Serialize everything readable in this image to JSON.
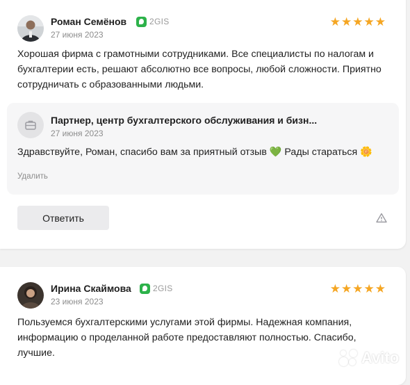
{
  "reviews": [
    {
      "author": "Роман Семёнов",
      "source": "2GIS",
      "date": "27 июня 2023",
      "rating": 5,
      "stars": "★★★★★",
      "text": "Хорошая фирма с грамотными сотрудниками. Все специалисты по налогам и бухгалтерии есть, решают абсолютно все вопросы, любой сложности. Приятно сотрудничать с образованными людьми.",
      "reply": {
        "author": "Партнер, центр бухгалтерского обслуживания и бизн...",
        "date": "27 июня 2023",
        "text": "Здравствуйте, Роман, спасибо вам за приятный отзыв 💚 Рады стараться 🌼",
        "delete_label": "Удалить"
      },
      "answer_label": "Ответить"
    },
    {
      "author": "Ирина Скаймова",
      "source": "2GIS",
      "date": "23 июня 2023",
      "rating": 5,
      "stars": "★★★★★",
      "text": "Пользуемся бухгалтерскими услугами этой фирмы. Надежная компания, информацию о проделанной работе предоставляют полностью. Спасибо, лучшие."
    }
  ],
  "watermark": "Avito",
  "colors": {
    "star": "#f5a623",
    "source_badge": "#2db24a",
    "muted_text": "#8c8c8c",
    "reply_bg": "#f6f6f7",
    "button_bg": "#ebebed"
  }
}
